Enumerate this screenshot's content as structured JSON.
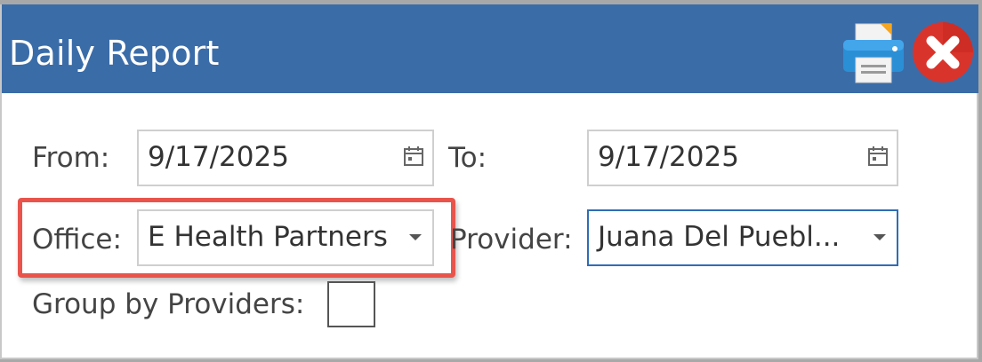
{
  "window": {
    "title": "Daily Report"
  },
  "toolbar": {
    "print_icon": "printer-icon",
    "close_icon": "close-icon"
  },
  "form": {
    "from_label": "From:",
    "from_value": "9/17/2025",
    "to_label": "To:",
    "to_value": "9/17/2025",
    "office_label": "Office:",
    "office_value": "E Health Partners",
    "provider_label": "Provider:",
    "provider_value": "Juana Del Puebl...",
    "group_label": "Group by Providers:",
    "group_checked": false
  },
  "colors": {
    "titlebar": "#3a6ca8",
    "highlight": "#e8544b",
    "provider_border": "#2f6db5"
  }
}
